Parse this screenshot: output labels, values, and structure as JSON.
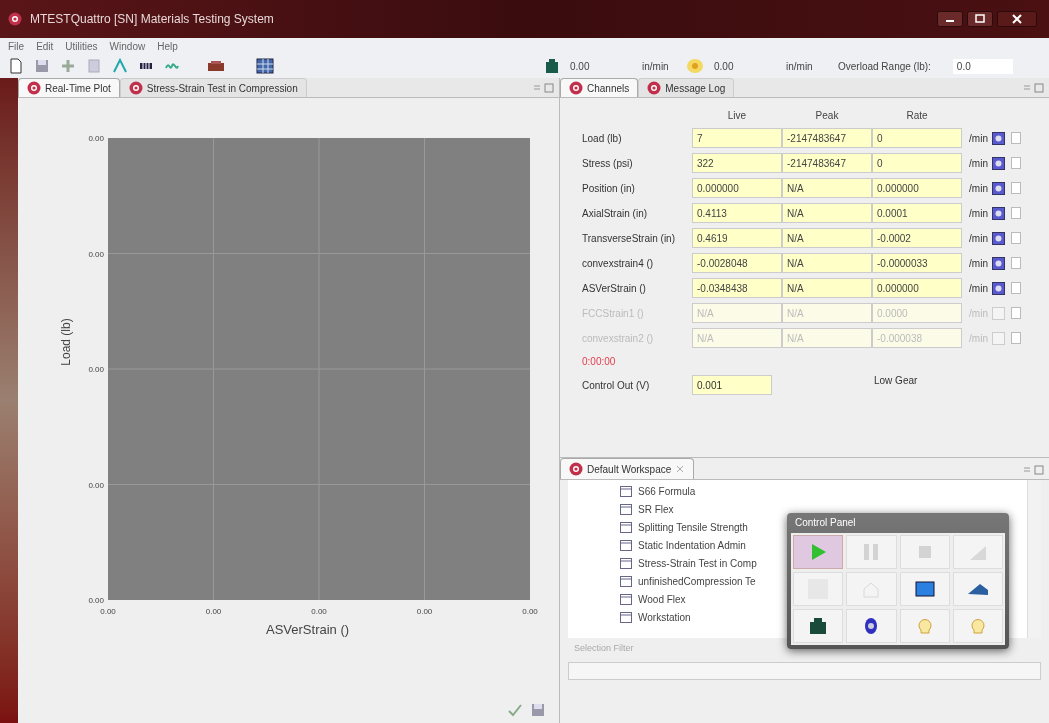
{
  "window": {
    "title": "MTESTQuattro [SN] Materials Testing System"
  },
  "menu": [
    "File",
    "Edit",
    "Utilities",
    "Window",
    "Help"
  ],
  "toolbar": {
    "speed_1": {
      "value": "0.00",
      "unit": "in/min"
    },
    "speed_2": {
      "value": "0.00",
      "unit": "in/min"
    },
    "overload": {
      "label": "Overload Range (lb):",
      "value": "0.0"
    }
  },
  "left_tabs": [
    {
      "label": "Real-Time Plot",
      "selected": true
    },
    {
      "label": "Stress-Strain Test in Compression",
      "selected": false
    }
  ],
  "plot": {
    "ylabel": "Load (lb)",
    "xlabel": "ASVerStrain ()",
    "yticks": [
      "0.00",
      "0.00",
      "0.00",
      "0.00",
      "0.00"
    ],
    "xticks": [
      "0.00",
      "0.00",
      "0.00",
      "0.00",
      "0.00"
    ]
  },
  "right_tabs": [
    {
      "label": "Channels",
      "selected": true
    },
    {
      "label": "Message Log",
      "selected": false
    }
  ],
  "channels": {
    "columns": [
      "Live",
      "Peak",
      "Rate"
    ],
    "rows": [
      {
        "name": "Load (lb)",
        "live": "7",
        "peak": "-2147483647",
        "rate": "0",
        "unit": "/min",
        "disabled": false,
        "checked": false
      },
      {
        "name": "Stress (psi)",
        "live": "322",
        "peak": "-2147483647",
        "rate": "0",
        "unit": "/min",
        "disabled": false,
        "checked": false
      },
      {
        "name": "Position (in)",
        "live": "0.000000",
        "peak": "N/A",
        "rate": "0.000000",
        "unit": "/min",
        "disabled": false,
        "checked": false
      },
      {
        "name": "AxialStrain (in)",
        "live": "0.4113",
        "peak": "N/A",
        "rate": "0.0001",
        "unit": "/min",
        "disabled": false,
        "checked": false
      },
      {
        "name": "TransverseStrain (in)",
        "live": "0.4619",
        "peak": "N/A",
        "rate": "-0.0002",
        "unit": "/min",
        "disabled": false,
        "checked": false
      },
      {
        "name": "convexstrain4 ()",
        "live": "-0.0028048",
        "peak": "N/A",
        "rate": "-0.0000033",
        "unit": "/min",
        "disabled": false,
        "checked": false
      },
      {
        "name": "ASVerStrain ()",
        "live": "-0.0348438",
        "peak": "N/A",
        "rate": "0.000000",
        "unit": "/min",
        "disabled": false,
        "checked": false
      },
      {
        "name": "FCCStrain1 ()",
        "live": "N/A",
        "peak": "N/A",
        "rate": "0.0000",
        "unit": "/min",
        "disabled": true,
        "checked": false
      },
      {
        "name": "convexstrain2 ()",
        "live": "N/A",
        "peak": "N/A",
        "rate": "-0.000038",
        "unit": "/min",
        "disabled": true,
        "checked": false
      }
    ],
    "timer": "0:00:00",
    "control_out": {
      "label": "Control Out (V)",
      "value": "0.001"
    },
    "gear": "Low Gear"
  },
  "workspace": {
    "tab": "Default Workspace",
    "items": [
      "S66 Formula",
      "SR Flex",
      "Splitting Tensile Strength",
      "Static Indentation Admin",
      "Stress-Strain Test in Comp",
      "unfinishedCompression Te",
      "Wood Flex",
      "Workstation"
    ],
    "filter_label": "Selection Filter"
  },
  "control_panel": {
    "title": "Control Panel",
    "buttons": [
      {
        "kind": "play",
        "disabled": false
      },
      {
        "kind": "pause",
        "disabled": true
      },
      {
        "kind": "stop",
        "disabled": true
      },
      {
        "kind": "ramp",
        "disabled": true
      },
      {
        "kind": "blank",
        "disabled": true
      },
      {
        "kind": "home",
        "disabled": true
      },
      {
        "kind": "select",
        "disabled": false
      },
      {
        "kind": "jog",
        "disabled": false
      },
      {
        "kind": "machine",
        "disabled": false
      },
      {
        "kind": "zero",
        "disabled": false
      },
      {
        "kind": "light",
        "disabled": false
      },
      {
        "kind": "light",
        "disabled": false
      }
    ]
  }
}
